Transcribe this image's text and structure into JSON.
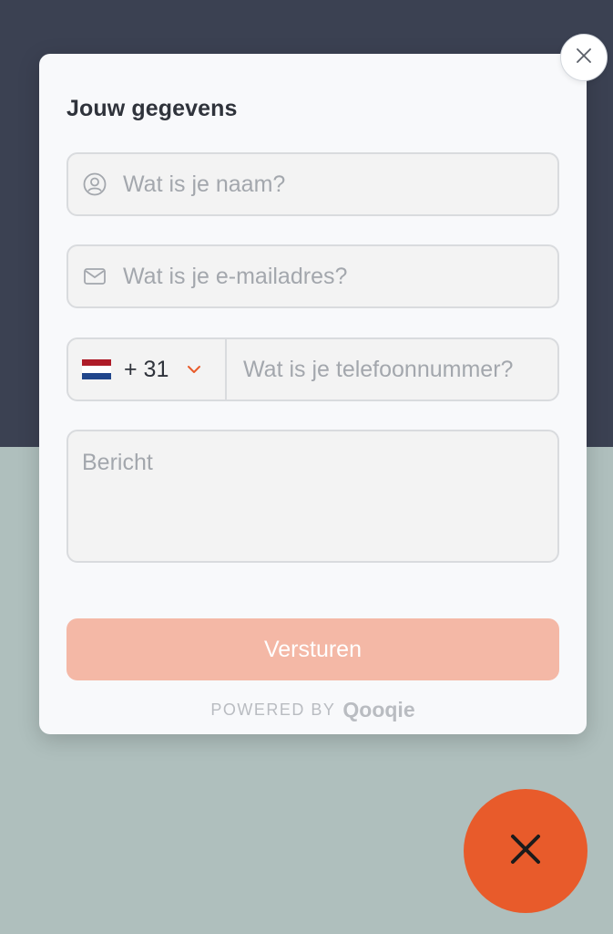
{
  "form": {
    "title": "Jouw gegevens",
    "name_placeholder": "Wat is je naam?",
    "email_placeholder": "Wat is je e-mailadres?",
    "phone": {
      "country_flag": "netherlands-flag",
      "dial_code": "+ 31",
      "placeholder": "Wat is je telefoonnummer?"
    },
    "message_placeholder": "Bericht",
    "submit_label": "Versturen"
  },
  "footer": {
    "powered_by": "POWERED BY",
    "brand": "Qooqie"
  },
  "icons": {
    "close_modal": "close-icon",
    "name": "user-icon",
    "email": "mail-icon",
    "dropdown": "chevron-down-icon",
    "launcher_close": "close-icon"
  },
  "colors": {
    "accent": "#e85b2b",
    "submit_disabled": "#f4b8a6",
    "backdrop_top": "#3b4152",
    "backdrop_bottom": "#afbfbd",
    "card": "#f8f9fb"
  }
}
